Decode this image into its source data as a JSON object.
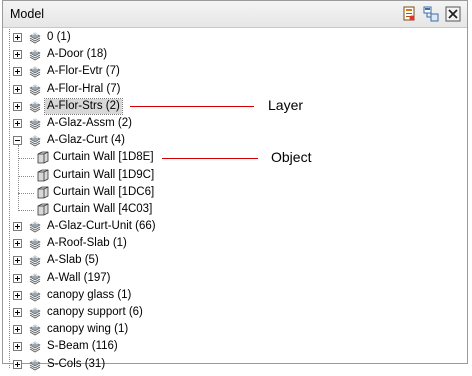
{
  "panel": {
    "title": "Model"
  },
  "toolbar": {
    "button_icons": [
      "settings-list-icon",
      "tree-view-icon",
      "close-icon"
    ]
  },
  "tree": {
    "layers": [
      {
        "label": "0 (1)",
        "expanded": false
      },
      {
        "label": "A-Door (18)",
        "expanded": false
      },
      {
        "label": "A-Flor-Evtr (7)",
        "expanded": false
      },
      {
        "label": "A-Flor-Hral (7)",
        "expanded": false
      },
      {
        "label": "A-Flor-Strs (2)",
        "expanded": false,
        "selected": true
      },
      {
        "label": "A-Glaz-Assm (2)",
        "expanded": false
      },
      {
        "label": "A-Glaz-Curt (4)",
        "expanded": true
      },
      {
        "label": "A-Glaz-Curt-Unit (66)",
        "expanded": false
      },
      {
        "label": "A-Roof-Slab (1)",
        "expanded": false
      },
      {
        "label": "A-Slab (5)",
        "expanded": false
      },
      {
        "label": "A-Wall (197)",
        "expanded": false
      },
      {
        "label": "canopy glass (1)",
        "expanded": false
      },
      {
        "label": "canopy support (6)",
        "expanded": false
      },
      {
        "label": "canopy wing (1)",
        "expanded": false
      },
      {
        "label": "S-Beam (116)",
        "expanded": false
      },
      {
        "label": "S-Cols (31)",
        "expanded": false
      }
    ],
    "objects": [
      {
        "label": "Curtain Wall [1D8E]"
      },
      {
        "label": "Curtain Wall [1D9C]"
      },
      {
        "label": "Curtain Wall [1DC6]"
      },
      {
        "label": "Curtain Wall [4C03]"
      }
    ]
  },
  "callouts": {
    "layer": "Layer",
    "object": "Object"
  },
  "colors": {
    "callout_line": "#d40000",
    "selection": "#d8d8d8"
  }
}
